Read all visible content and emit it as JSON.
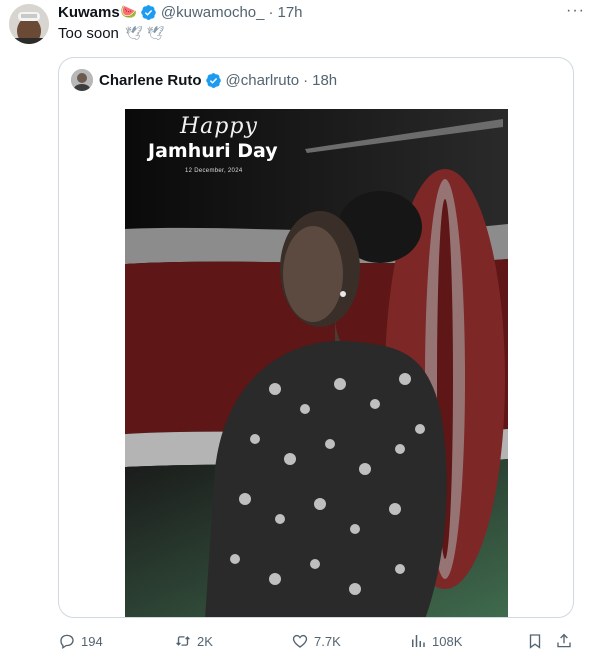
{
  "tweet": {
    "author_name": "Kuwams",
    "author_emoji": "🍉",
    "handle": "@kuwamocho_",
    "separator": "·",
    "time": "17h",
    "text": "Too soon",
    "text_emojis": "🕊 🕊",
    "more_label": "···"
  },
  "quoted": {
    "author_name": "Charlene Ruto",
    "handle": "@charlruto",
    "separator": "·",
    "time": "18h",
    "image": {
      "happy": "Happy",
      "title": "Jamhuri Day",
      "date": "12 December, 2024"
    }
  },
  "actions": {
    "replies": "194",
    "reposts": "2K",
    "likes": "7.7K",
    "views": "108K"
  },
  "colors": {
    "verified": "#1d9bf0",
    "muted": "#536471",
    "border": "#cfd9de"
  }
}
